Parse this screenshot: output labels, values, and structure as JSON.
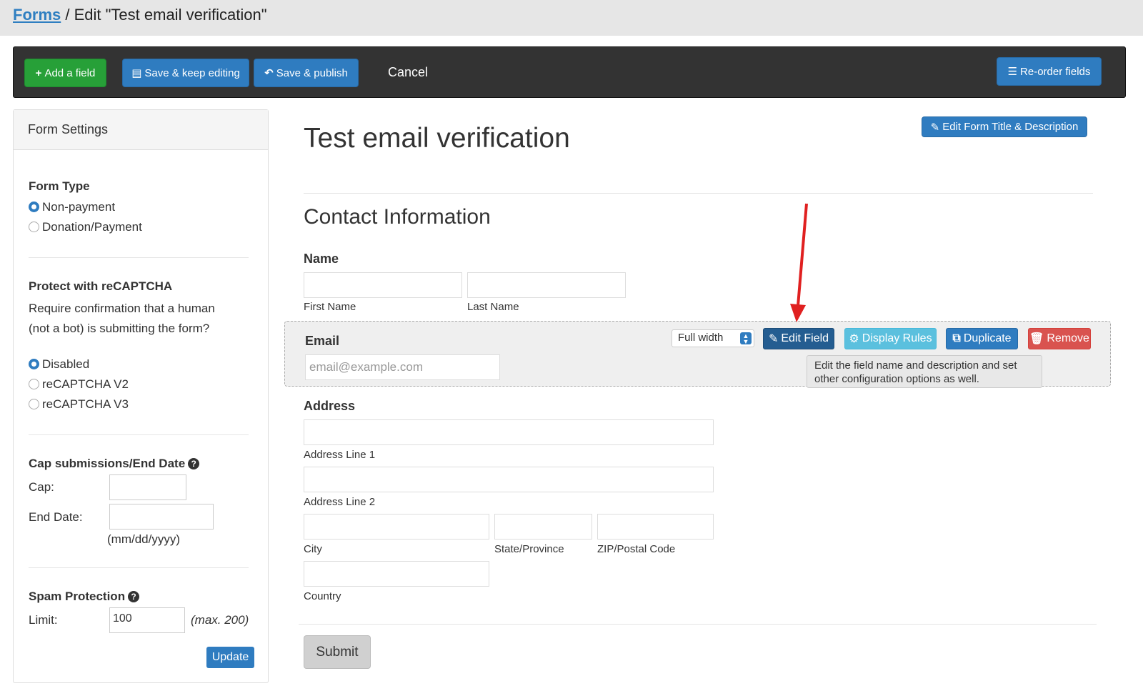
{
  "breadcrumb": {
    "link": "Forms",
    "current": " / Edit \"Test email verification\""
  },
  "toolbar": {
    "add_field": "Add a field",
    "save_keep": "Save & keep editing",
    "save_publish": "Save & publish",
    "cancel": "Cancel",
    "reorder": "Re-order fields"
  },
  "sidebar": {
    "title": "Form Settings",
    "form_type": {
      "heading": "Form Type",
      "options": [
        "Non-payment",
        "Donation/Payment"
      ],
      "selected": "Non-payment"
    },
    "recaptcha": {
      "heading": "Protect with reCAPTCHA",
      "description": "Require confirmation that a human (not a bot) is submitting the form?",
      "options": [
        "Disabled",
        "reCAPTCHA V2",
        "reCAPTCHA V3"
      ],
      "selected": "Disabled"
    },
    "cap": {
      "heading": "Cap submissions/End Date",
      "cap_label": "Cap:",
      "end_label": "End Date:",
      "date_hint": "(mm/dd/yyyy)"
    },
    "spam": {
      "heading": "Spam Protection",
      "limit_label": "Limit:",
      "limit_value": "100",
      "max_hint": "(max. 200)",
      "update": "Update"
    }
  },
  "main": {
    "edit_title_button": "Edit Form Title & Description",
    "title": "Test email verification",
    "section": "Contact Information",
    "name": {
      "label": "Name",
      "first": "First Name",
      "last": "Last Name"
    },
    "email": {
      "label": "Email",
      "placeholder": "email@example.com",
      "width_select": "Full width",
      "edit_field": "Edit Field",
      "display_rules": "Display Rules",
      "duplicate": "Duplicate",
      "remove": "Remove",
      "tooltip": "Edit the field name and description and set other configuration options as well."
    },
    "address": {
      "label": "Address",
      "line1": "Address Line 1",
      "line2": "Address Line 2",
      "city": "City",
      "state": "State/Province",
      "zip": "ZIP/Postal Code",
      "country": "Country"
    },
    "submit": "Submit"
  },
  "colors": {
    "primary": "#2f7cc0",
    "success": "#27a038",
    "info": "#5bc0de",
    "danger": "#d9534f",
    "dark_primary": "#245d91"
  }
}
